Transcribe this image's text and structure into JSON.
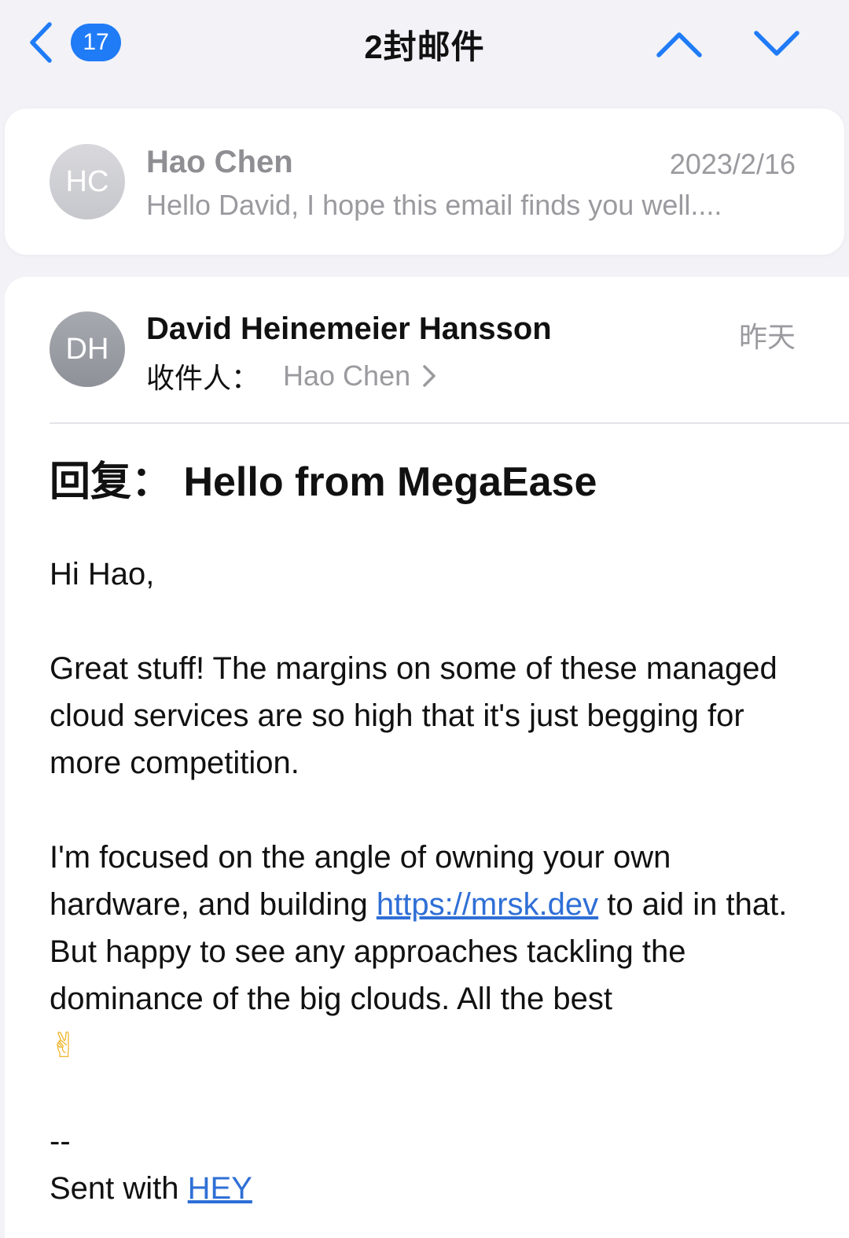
{
  "nav": {
    "badge_count": "17",
    "title": "2封邮件"
  },
  "collapsed_message": {
    "avatar_initials": "HC",
    "sender": "Hao Chen",
    "date": "2023/2/16",
    "preview": "Hello David, I hope this email finds you well...."
  },
  "message": {
    "avatar_initials": "DH",
    "sender": "David Heinemeier Hansson",
    "date": "昨天",
    "to_label": "收件人：",
    "to_name": "Hao Chen",
    "subject": "回复： Hello from MegaEase",
    "greeting": "Hi Hao,",
    "para1": "Great stuff! The margins on some of these managed cloud services are so high that it's just begging for more competition.",
    "para2_before_link": "I'm focused on the angle of owning your own hardware, and building ",
    "link_text": "https://mrsk.dev",
    "para2_after_link": " to aid in that. But happy to see any approaches tackling the dominance of the big clouds. All the best",
    "emoji": "✌",
    "signature_dashes": "--",
    "sent_with_label": "Sent with ",
    "sent_with_link": "HEY"
  },
  "colors": {
    "accent": "#1f7bf6",
    "link": "#2f6fd6",
    "background": "#f2f2f7"
  },
  "icons": {
    "back": "chevron-left-icon",
    "previous": "chevron-up-icon",
    "next": "chevron-down-icon",
    "recipient_expand": "chevron-right-icon"
  }
}
